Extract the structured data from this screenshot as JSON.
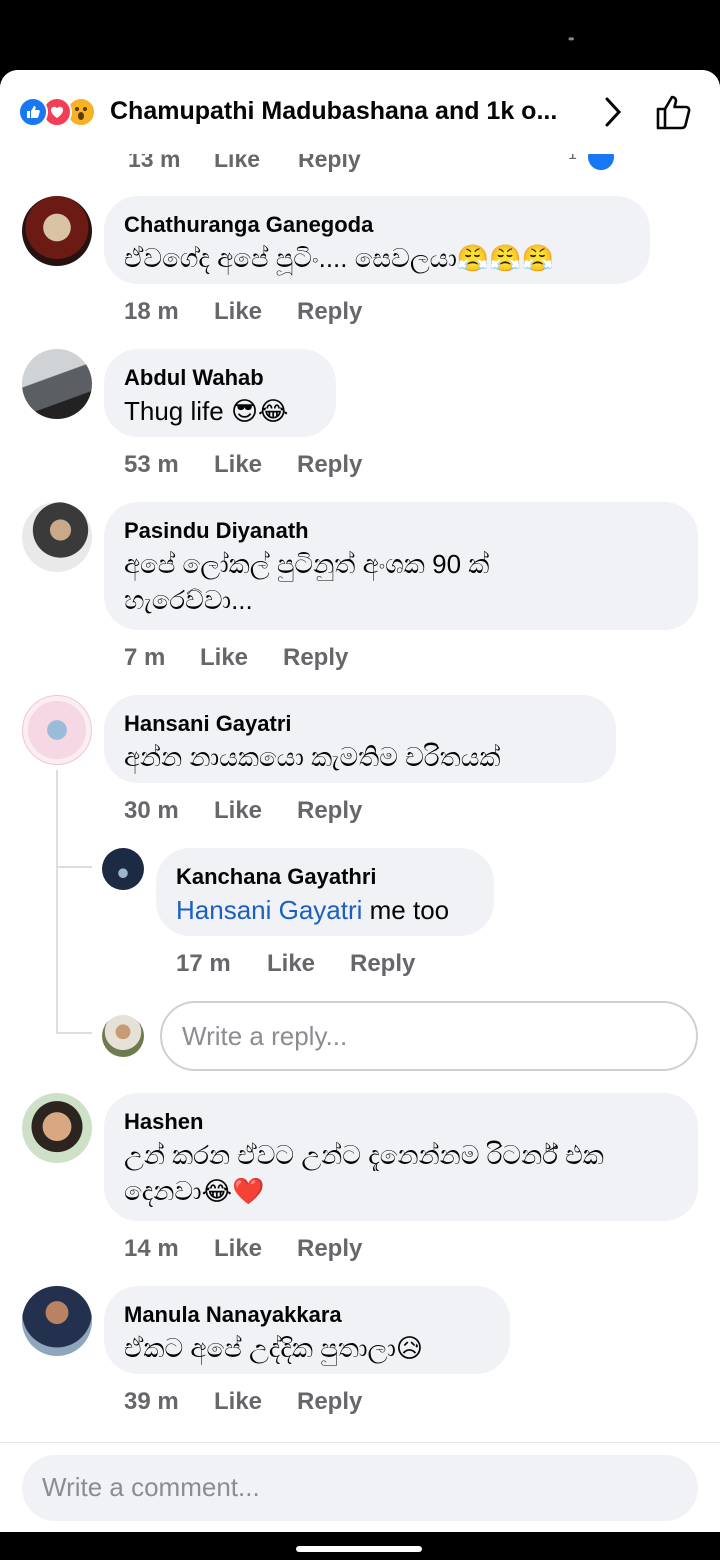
{
  "header": {
    "title": "Chamupathi Madubashana and 1k o...",
    "reaction_icons": [
      "like-reaction-icon",
      "love-reaction-icon",
      "wow-reaction-icon"
    ],
    "like_button_icon": "thumbs-up-icon"
  },
  "cutoff_row": {
    "time": "13 m",
    "like": "Like",
    "reply": "Reply",
    "count": "1"
  },
  "comments": [
    {
      "name": "Chathuranga Ganegoda",
      "text": "ඒවගේද අපේ පූටිං.... සෙවලයා😤😤😤",
      "time": "18 m",
      "like": "Like",
      "reply": "Reply"
    },
    {
      "name": "Abdul Wahab",
      "text": "Thug life 😎😂",
      "time": "53 m",
      "like": "Like",
      "reply": "Reply"
    },
    {
      "name": "Pasindu Diyanath",
      "text": "අපේ ලෝකල් පුටිනුත් අංශක 90 ක් හැරෙව්වා...",
      "time": "7 m",
      "like": "Like",
      "reply": "Reply"
    },
    {
      "name": "Hansani Gayatri",
      "text": "අන්න නායකයො කැමතිම චරිතයක්",
      "time": "30 m",
      "like": "Like",
      "reply": "Reply"
    },
    {
      "name": "Hashen",
      "text": "උන් කරන ඒවට උන්ට දැනෙන්නම රිටර්න් එක දෙනවා😂❤️",
      "time": "14 m",
      "like": "Like",
      "reply": "Reply"
    },
    {
      "name": "Manula Nanayakkara",
      "text": "ඒකට අපේ උද්දික පුතාලා😥",
      "time": "39 m",
      "like": "Like",
      "reply": "Reply"
    }
  ],
  "reply": {
    "name": "Kanchana Gayathri",
    "mention": "Hansani Gayatri",
    "text": " me too",
    "time": "17 m",
    "like": "Like",
    "reply": "Reply"
  },
  "reply_input": {
    "placeholder": "Write a reply..."
  },
  "comment_input": {
    "placeholder": "Write a comment..."
  },
  "colors": {
    "accent": "#1877f2",
    "bubble": "#f0f2f5",
    "meta": "#65676b",
    "mention": "#1b5fc5"
  }
}
